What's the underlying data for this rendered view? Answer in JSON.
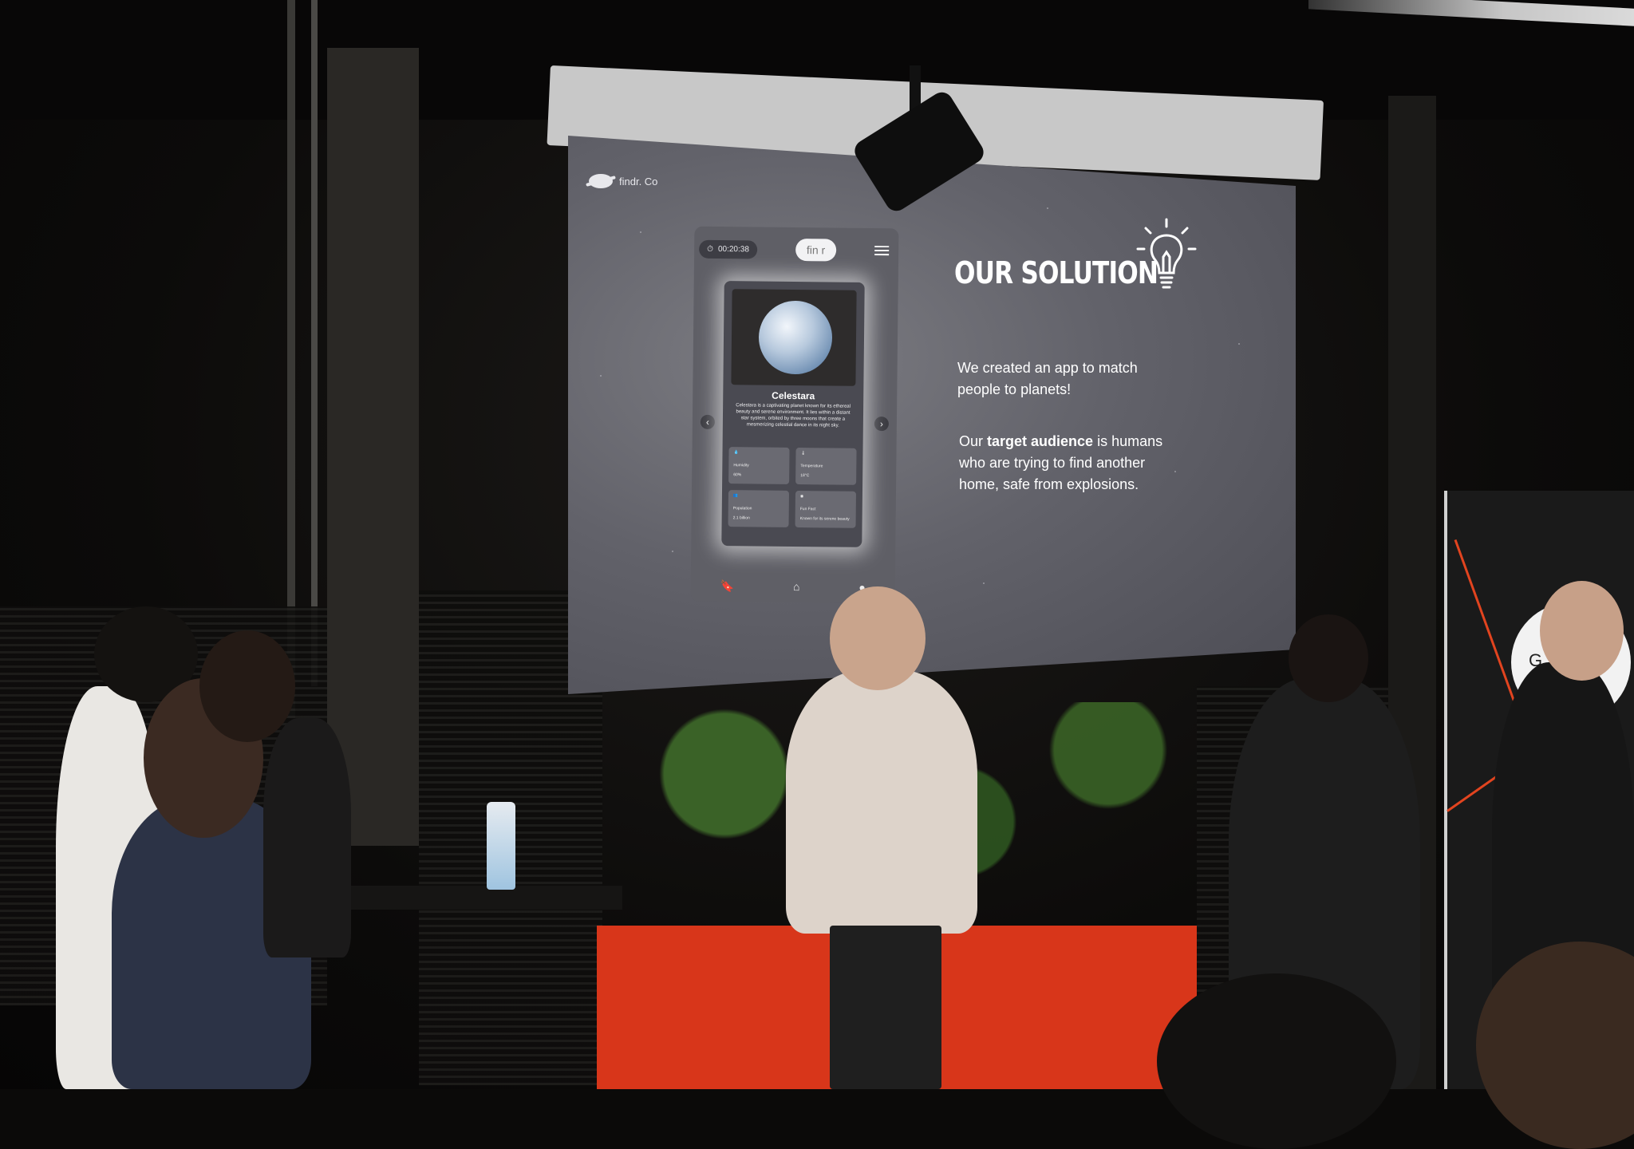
{
  "screen": {
    "brand_text": "findr. Co",
    "heading": "OUR SOLUTION",
    "paragraph1_line1": "We created an app to match",
    "paragraph1_line2": "people to planets!",
    "paragraph2_prefix": "Our ",
    "paragraph2_bold": "target audience",
    "paragraph2_suffix": " is humans",
    "paragraph2_line2": "who are trying to find another",
    "paragraph2_line3": "home, safe from explosions.",
    "bulb_icon": "lightbulb-icon"
  },
  "phone": {
    "timer": "00:20:38",
    "logo": "fin r",
    "menu_icon": "hamburger-menu-icon",
    "planet_name": "Celestara",
    "planet_description": "Celestara is a captivating planet known for its ethereal beauty and serene environment. It lies within a distant star system, orbited by three moons that create a mesmerizing celestial dance in its night sky.",
    "stats": [
      {
        "label": "Humidity",
        "value": "60%"
      },
      {
        "label": "Temperature",
        "value": "18°C"
      },
      {
        "label": "Population",
        "value": "2.1 billion"
      },
      {
        "label": "Fun Fact",
        "value": "Known for its serene beauty"
      }
    ],
    "prev_icon": "chevron-left-icon",
    "next_icon": "chevron-right-icon",
    "nav_icons": [
      "bookmark-icon",
      "home-icon",
      "profile-icon"
    ]
  },
  "banner_letter": "G",
  "colors": {
    "screen_bg": "#5e5e66",
    "planter": "#d8361a",
    "banner_accent": "#e2441f"
  }
}
